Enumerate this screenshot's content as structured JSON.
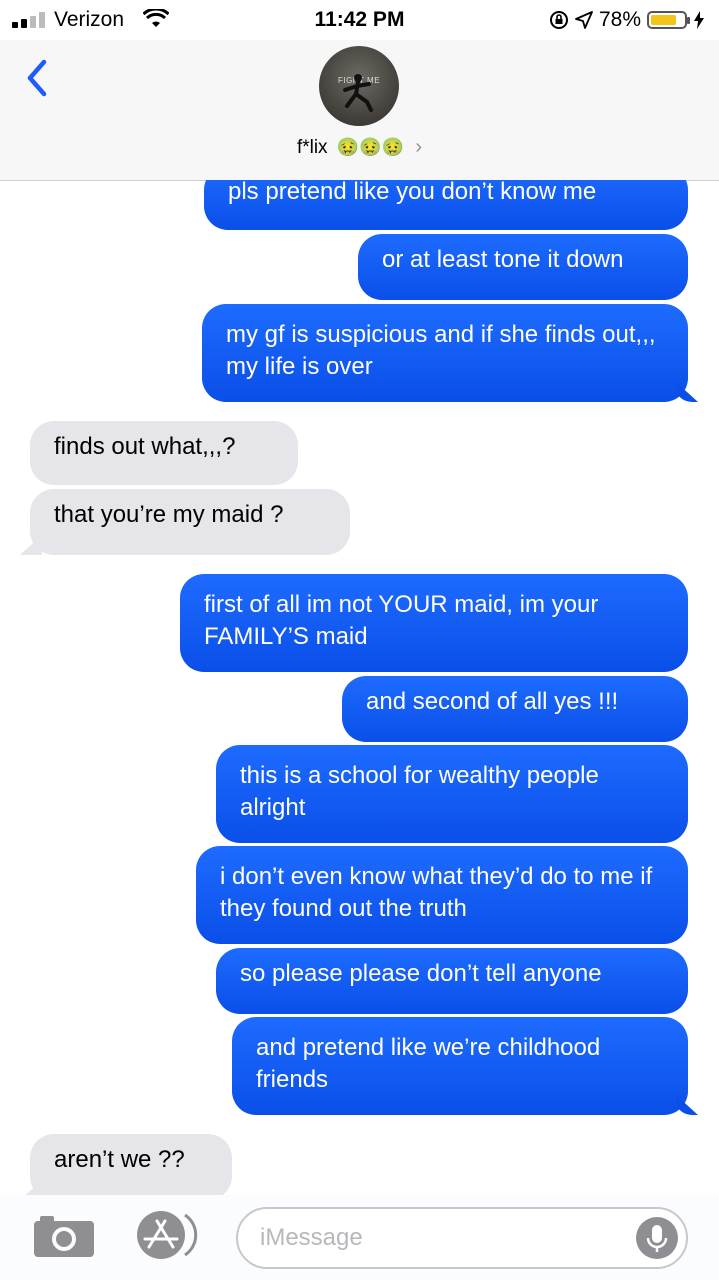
{
  "status_bar": {
    "carrier": "Verizon",
    "time": "11:42 PM",
    "battery_percent": "78%",
    "battery_level": 0.78,
    "icons": [
      "signal-icon",
      "wifi-icon",
      "orientation-lock-icon",
      "location-icon",
      "battery-icon",
      "charging-icon"
    ],
    "battery_color": "#f2c518"
  },
  "header": {
    "avatar_caption": "FIGHT ME",
    "contact_name": "f*lix",
    "contact_emojis": "🤢🤢🤢",
    "chevron": "›"
  },
  "messages": [
    {
      "from": "me",
      "text": "pls pretend like you don’t know me"
    },
    {
      "from": "me",
      "text": "or at least tone it down"
    },
    {
      "from": "me",
      "text": "my gf is suspicious and if she finds out,,, my life is over"
    },
    {
      "from": "them",
      "text": "finds out what,,,?"
    },
    {
      "from": "them",
      "text": "that you’re my maid ?"
    },
    {
      "from": "me",
      "text": "first of all im not YOUR maid, im your FAMILY’S maid"
    },
    {
      "from": "me",
      "text": "and second of all yes !!!"
    },
    {
      "from": "me",
      "text": "this is a school for wealthy people alright"
    },
    {
      "from": "me",
      "text": "i don’t even know what they’d do to me if they found out the truth"
    },
    {
      "from": "me",
      "text": "so please please don’t tell anyone"
    },
    {
      "from": "me",
      "text": "and pretend like we’re childhood friends"
    },
    {
      "from": "them",
      "text": "aren’t we ??"
    }
  ],
  "input_bar": {
    "placeholder": "iMessage"
  },
  "colors": {
    "sent_bubble": "#0a4fe8",
    "received_bubble": "#e5e5ea",
    "accent": "#1e5bff"
  }
}
